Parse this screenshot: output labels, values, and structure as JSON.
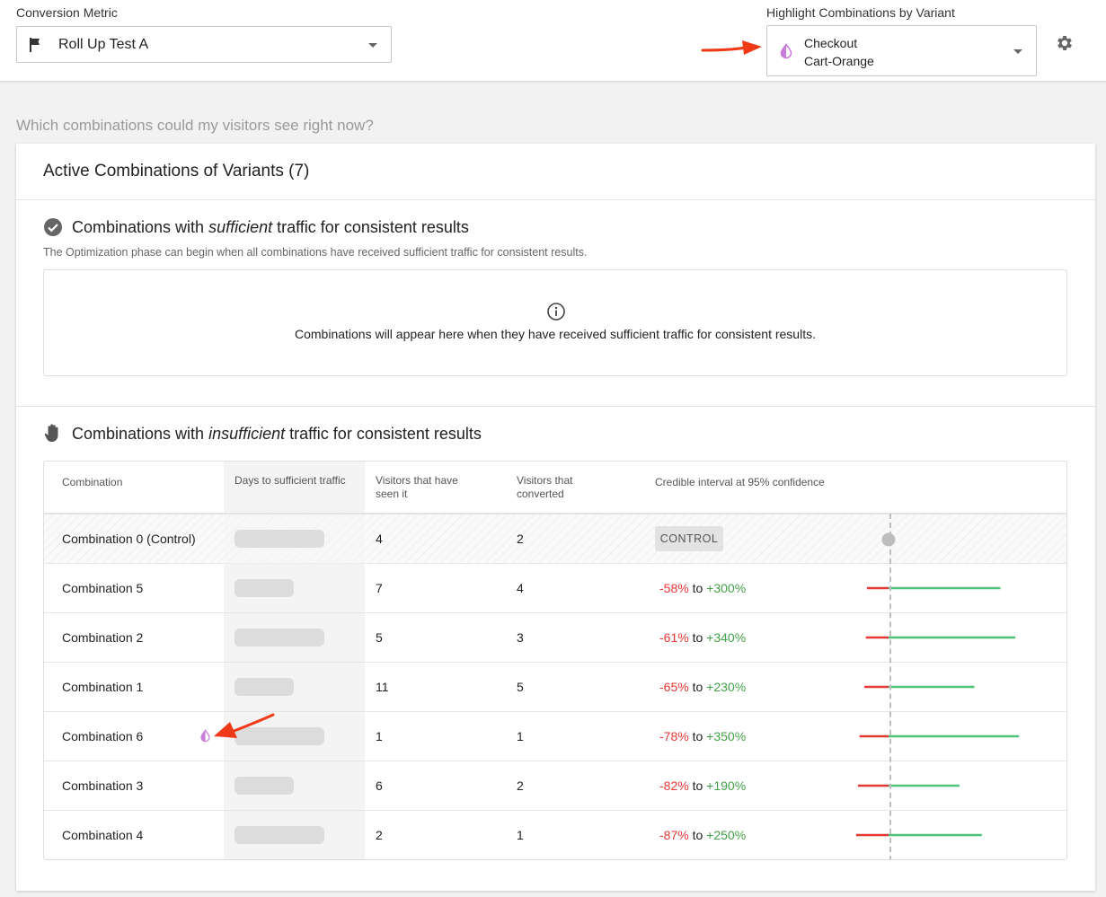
{
  "header": {
    "metric_label": "Conversion Metric",
    "metric_value": "Roll Up Test A",
    "highlight_label": "Highlight Combinations by Variant",
    "highlight_line1": "Checkout",
    "highlight_line2": "Cart-Orange",
    "settings_icon": "gear-icon"
  },
  "question": "Which combinations could my visitors see right now?",
  "card": {
    "title": "Active Combinations of Variants (7)",
    "sufficient": {
      "pre": "Combinations with ",
      "em": "sufficient",
      "post": " traffic for consistent results",
      "description": "The Optimization phase can begin when all combinations have received sufficient traffic for consistent results.",
      "empty_message": "Combinations will appear here when they have received sufficient traffic for consistent results."
    },
    "insufficient": {
      "pre": "Combinations with ",
      "em": "insufficient",
      "post": " traffic for consistent results"
    }
  },
  "table": {
    "headers": {
      "combination": "Combination",
      "days": "Days to sufficient traffic",
      "visitors_seen": "Visitors that have seen it",
      "visitors_converted": "Visitors that converted",
      "credible": "Credible interval at 95% confidence"
    },
    "to_word": "to",
    "control_label": "CONTROL",
    "rows": [
      {
        "name": "Combination 0 (Control)",
        "seen": "4",
        "converted": "2",
        "control": true
      },
      {
        "name": "Combination 5",
        "seen": "7",
        "converted": "4",
        "low": "-58%",
        "high": "+300%",
        "low_val": -58,
        "high_val": 300
      },
      {
        "name": "Combination 2",
        "seen": "5",
        "converted": "3",
        "low": "-61%",
        "high": "+340%",
        "low_val": -61,
        "high_val": 340
      },
      {
        "name": "Combination 1",
        "seen": "11",
        "converted": "5",
        "low": "-65%",
        "high": "+230%",
        "low_val": -65,
        "high_val": 230
      },
      {
        "name": "Combination 6",
        "seen": "1",
        "converted": "1",
        "low": "-78%",
        "high": "+350%",
        "low_val": -78,
        "high_val": 350,
        "highlighted": true
      },
      {
        "name": "Combination 3",
        "seen": "6",
        "converted": "2",
        "low": "-82%",
        "high": "+190%",
        "low_val": -82,
        "high_val": 190
      },
      {
        "name": "Combination 4",
        "seen": "2",
        "converted": "1",
        "low": "-87%",
        "high": "+250%",
        "low_val": -87,
        "high_val": 250
      }
    ]
  },
  "colors": {
    "negative": "#e53935",
    "positive": "#43a047",
    "variant_highlight": "#c77ed9",
    "annotation_arrow": "#f03a17"
  }
}
